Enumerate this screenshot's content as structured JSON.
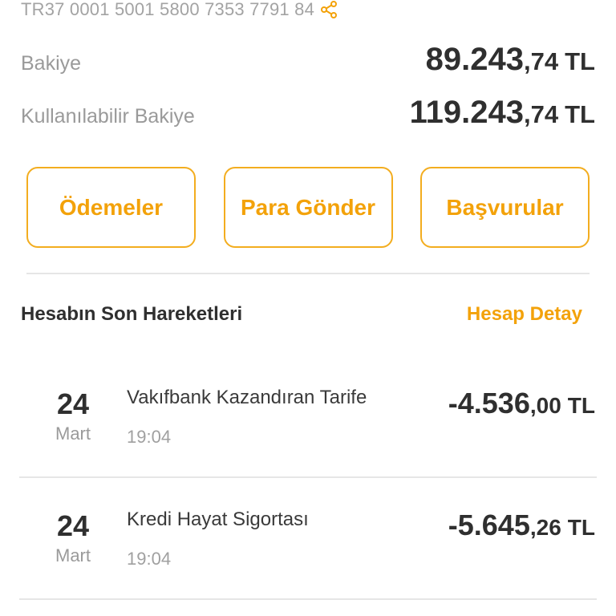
{
  "account": {
    "iban": "TR37 0001 5001 5800 7353 7791 84",
    "share_icon": "share-icon"
  },
  "balances": [
    {
      "label": "Bakiye",
      "int": "89.243",
      "dec": ",74",
      "currency": "TL"
    },
    {
      "label": "Kullanılabilir Bakiye",
      "int": "119.243",
      "dec": ",74",
      "currency": "TL"
    }
  ],
  "actions": [
    {
      "label": "Ödemeler"
    },
    {
      "label": "Para Gönder"
    },
    {
      "label": "Başvurular"
    }
  ],
  "section": {
    "title": "Hesabın Son Hareketleri",
    "link": "Hesap Detay"
  },
  "transactions": [
    {
      "day": "24",
      "month": "Mart",
      "description": "Vakıfbank Kazandıran Tarife",
      "time": "19:04",
      "int": "-4.536",
      "dec": ",00",
      "currency": "TL"
    },
    {
      "day": "24",
      "month": "Mart",
      "description": "Kredi Hayat Sigortası",
      "time": "19:04",
      "int": "-5.645",
      "dec": ",26",
      "currency": "TL"
    }
  ],
  "colors": {
    "accent": "#f3a20a",
    "accent_border": "#f3ad1f",
    "muted": "#9a9a9a",
    "text": "#2f2f2f"
  }
}
